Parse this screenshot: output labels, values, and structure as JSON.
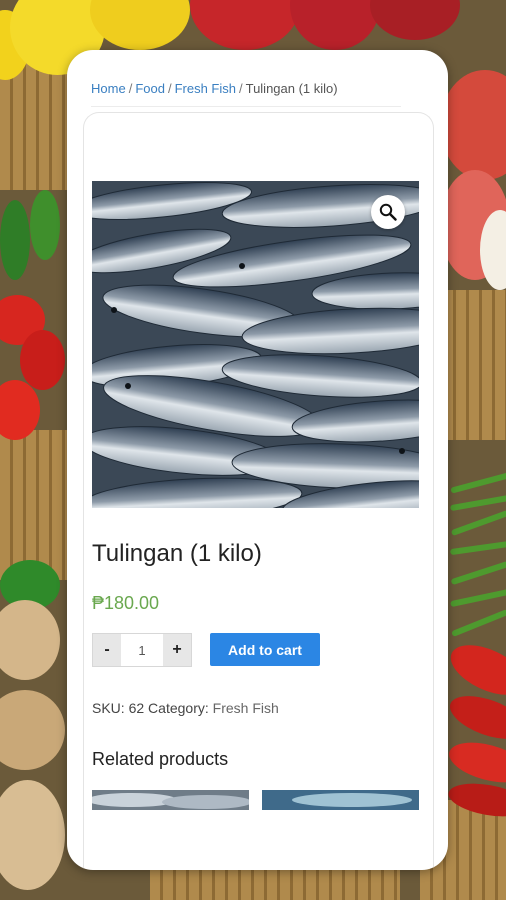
{
  "breadcrumb": {
    "home": "Home",
    "food": "Food",
    "category": "Fresh Fish",
    "current": "Tulingan (1 kilo)",
    "separator": "/"
  },
  "product": {
    "title": "Tulingan (1 kilo)",
    "price": "₱180.00",
    "image_alt": "Tulingan fish",
    "zoom_icon": "magnifier-icon"
  },
  "cart": {
    "minus_label": "-",
    "plus_label": "+",
    "quantity_value": "1",
    "add_label": "Add to cart"
  },
  "meta": {
    "sku_label": "SKU:",
    "sku_value": "62",
    "category_label": "Category:",
    "category_value": "Fresh Fish"
  },
  "related": {
    "heading": "Related products"
  },
  "colors": {
    "link": "#3a7fc1",
    "price": "#6aa84f",
    "button": "#2b86e4"
  }
}
